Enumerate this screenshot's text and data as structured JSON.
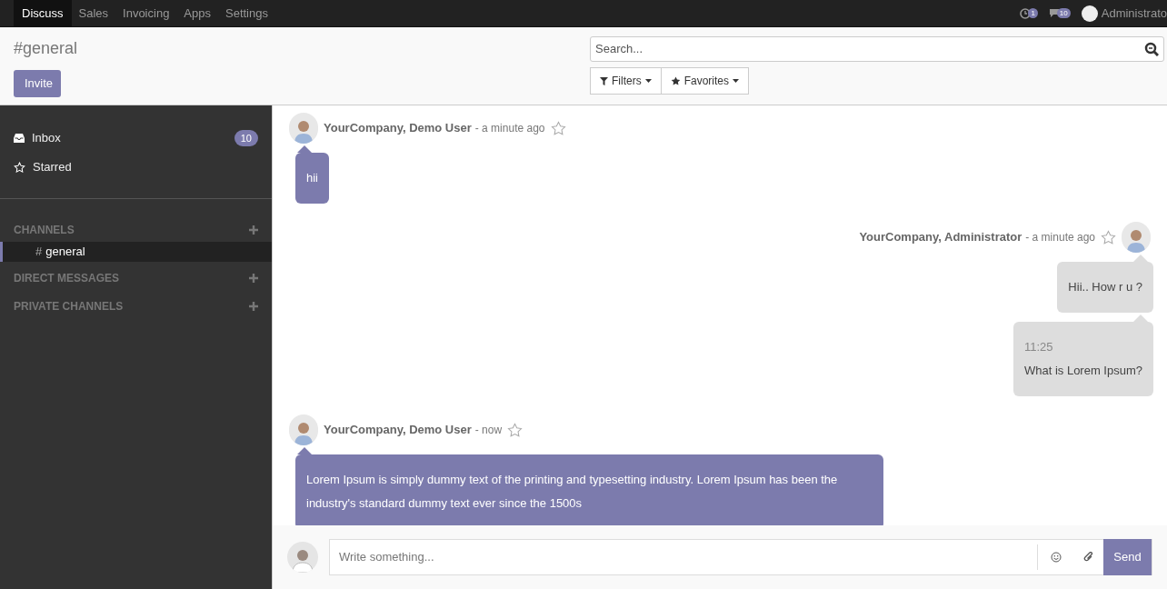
{
  "menu": [
    {
      "label": "Discuss",
      "selected": true
    },
    {
      "label": "Sales",
      "selected": false
    },
    {
      "label": "Invoicing",
      "selected": false
    },
    {
      "label": "Apps",
      "selected": false
    },
    {
      "label": "Settings",
      "selected": false
    }
  ],
  "systray": {
    "activity_count": "1",
    "message_count": "10",
    "user": "Administrato"
  },
  "breadcrumb": "#general",
  "invite_button": "Invite",
  "search": {
    "placeholder": "Search..."
  },
  "filter_buttons": [
    {
      "kind": "filter",
      "label": "Filters"
    },
    {
      "kind": "favorite",
      "label": "Favorites"
    }
  ],
  "sidebar": {
    "items": [
      {
        "kind": "inbox",
        "label": "Inbox",
        "badge": "10"
      },
      {
        "kind": "starred",
        "label": "Starred"
      }
    ],
    "sections": [
      {
        "title": "CHANNELS",
        "channels": [
          {
            "prefix": "#",
            "label": "general",
            "selected": true
          }
        ]
      },
      {
        "title": "DIRECT MESSAGES"
      },
      {
        "title": "PRIVATE CHANNELS"
      }
    ]
  },
  "messages": [
    {
      "kind": "received",
      "author": "YourCompany, Demo User",
      "time": "- a minute ago",
      "starred": false,
      "bubbles": [
        {
          "text": "hii"
        }
      ]
    },
    {
      "kind": "sent",
      "author": "YourCompany, Administrator",
      "time": "- a minute ago",
      "starred": false,
      "bubbles": [
        {
          "text": "Hii.. How r u ?"
        },
        {
          "timestamp": "11:25",
          "text": "What is Lorem Ipsum?"
        }
      ]
    },
    {
      "kind": "received",
      "author": "YourCompany, Demo User",
      "time": "- now",
      "starred": false,
      "bubbles": [
        {
          "text": "Lorem Ipsum is simply dummy text of the printing and typesetting industry. Lorem Ipsum has been the industry's standard dummy text ever since the 1500s"
        }
      ]
    }
  ],
  "composer": {
    "placeholder": "Write something...",
    "send_button": "Send"
  }
}
